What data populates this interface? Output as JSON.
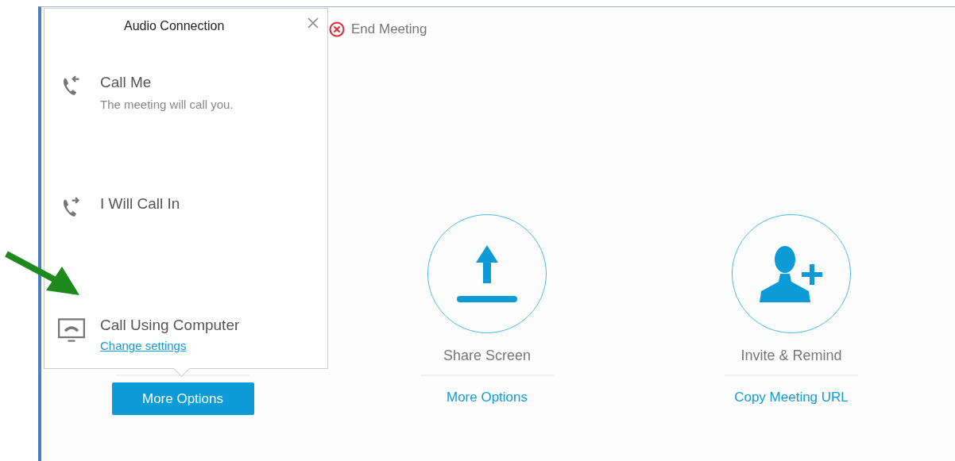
{
  "toolbar": {
    "end_meeting": "End Meeting"
  },
  "popup": {
    "title": "Audio Connection",
    "options": [
      {
        "kind": "call_me",
        "label": "Call Me",
        "description": "The meeting will call you."
      },
      {
        "kind": "call_in",
        "label": "I Will Call In"
      },
      {
        "kind": "computer",
        "label": "Call Using Computer",
        "link": "Change settings"
      }
    ]
  },
  "tiles": [
    {
      "kind": "computer",
      "action": {
        "kind": "button",
        "text": "More Options"
      }
    },
    {
      "kind": "share",
      "label": "Share Screen",
      "action": {
        "kind": "link",
        "text": "More Options"
      }
    },
    {
      "kind": "invite",
      "label": "Invite & Remind",
      "action": {
        "kind": "link",
        "text": "Copy Meeting URL"
      }
    }
  ]
}
